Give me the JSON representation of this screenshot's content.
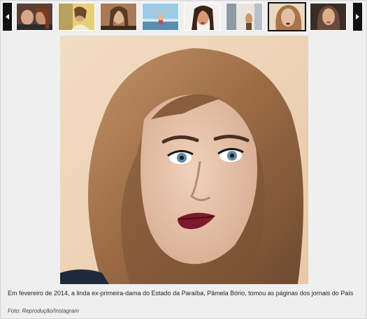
{
  "gallery": {
    "prev_icon": "chevron-left-icon",
    "next_icon": "chevron-right-icon",
    "thumbnails": [
      {
        "name": "thumb-1",
        "active": false,
        "colors": [
          "#6b4a3a",
          "#c9a083",
          "#2b2b2b"
        ]
      },
      {
        "name": "thumb-2",
        "active": false,
        "colors": [
          "#e8d070",
          "#c78a5a",
          "#f2e6c0"
        ]
      },
      {
        "name": "thumb-3",
        "active": false,
        "colors": [
          "#8a5a3a",
          "#d9b08a",
          "#3a2a20"
        ]
      },
      {
        "name": "thumb-4",
        "active": false,
        "colors": [
          "#8fc0e0",
          "#e3c9a3",
          "#5a8fb0"
        ]
      },
      {
        "name": "thumb-5",
        "active": false,
        "colors": [
          "#f3f0ee",
          "#c88a6a",
          "#3a2418"
        ]
      },
      {
        "name": "thumb-6",
        "active": false,
        "colors": [
          "#9aa6b0",
          "#e9e3dc",
          "#c79a70"
        ]
      },
      {
        "name": "thumb-7",
        "active": true,
        "colors": [
          "#d8c2a8",
          "#b5835a",
          "#4a3020"
        ]
      },
      {
        "name": "thumb-8",
        "active": false,
        "colors": [
          "#3a2c26",
          "#d8a888",
          "#6a4a38"
        ]
      }
    ]
  },
  "caption": "Em fevereiro de 2014, a linda ex-primeira-dama do Estado da Paraíba, Pâmela Bório, tomou as páginas dos jornais do País",
  "credit": "Foto: Reprodução/Instagram",
  "colors": {
    "background": "#efefef",
    "arrow": "#111111"
  }
}
